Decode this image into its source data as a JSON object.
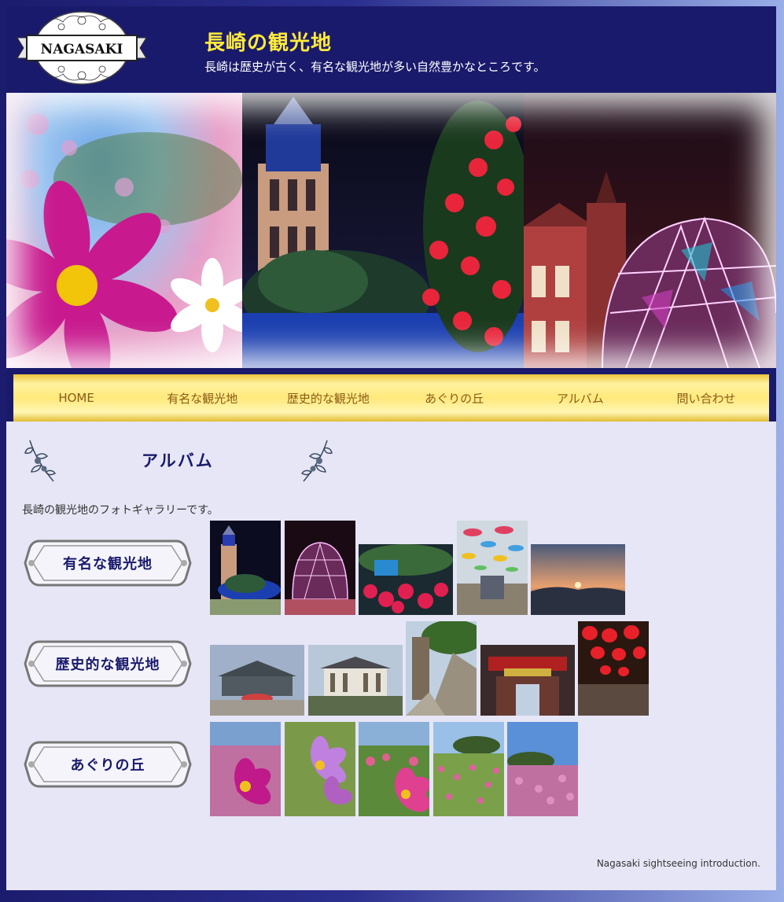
{
  "header": {
    "logo_text": "NAGASAKI",
    "title": "長崎の観光地",
    "subtitle": "長崎は歴史が古く、有名な観光地が多い自然豊かなところです。"
  },
  "nav": {
    "items": [
      "HOME",
      "有名な観光地",
      "歴史的な観光地",
      "あぐりの丘",
      "アルバム",
      "問い合わせ"
    ]
  },
  "main": {
    "section_title": "アルバム",
    "intro": "長崎の観光地のフォトギャラリーです。",
    "categories": [
      {
        "label": "有名な観光地"
      },
      {
        "label": "歴史的な観光地"
      },
      {
        "label": "あぐりの丘"
      }
    ]
  },
  "footer": {
    "text": "Nagasaki sightseeing introduction."
  },
  "colors": {
    "header_bg": "#1a1a6c",
    "title": "#ffeb3b",
    "nav_text": "#8a5a1a",
    "accent_navy": "#1a1a6c",
    "content_bg": "#e6e6f6"
  },
  "icons": [
    "leaf-ornament-icon",
    "frame-ornament-icon"
  ]
}
